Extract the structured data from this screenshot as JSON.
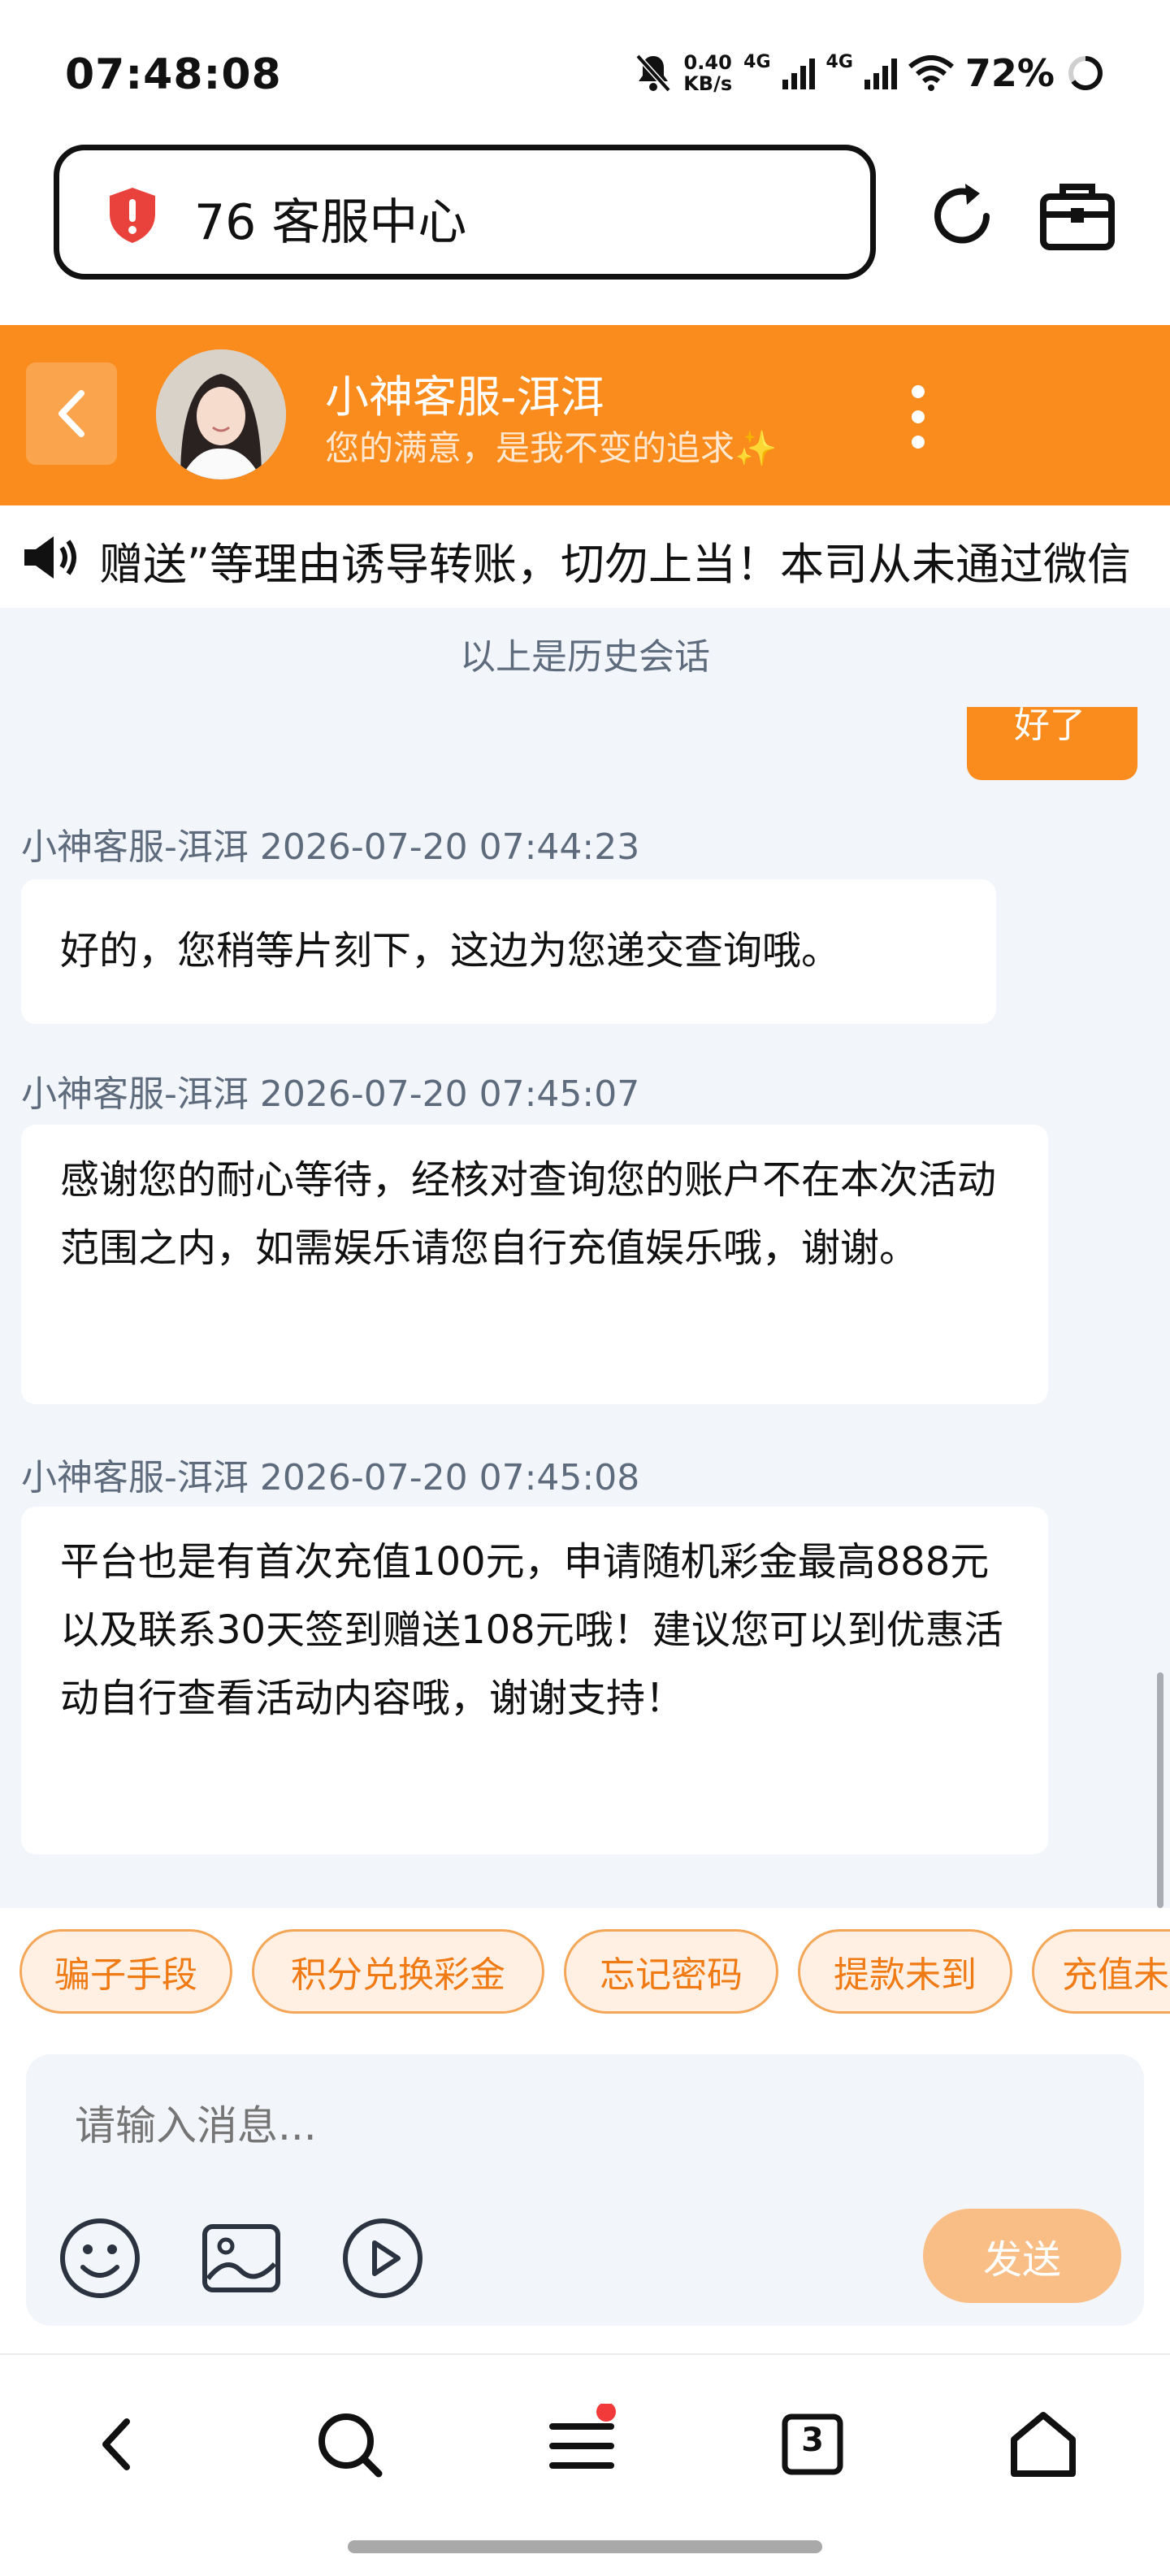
{
  "status_bar": {
    "time": "07:48:08",
    "speed_value": "0.40",
    "speed_unit": "KB/s",
    "net1": "4G",
    "net2": "4G",
    "battery": "72%"
  },
  "browser": {
    "address": "76 客服中心",
    "tab_count": "3"
  },
  "chat_header": {
    "agent_name": "小神客服-洱洱",
    "slogan": "您的满意，是我不变的追求✨"
  },
  "notice": {
    "text": "赠送”等理由诱导转账，切勿上当！本司从未通过微信"
  },
  "chat": {
    "history_label": "以上是历史会话",
    "user_message": "好了",
    "messages": [
      {
        "sender": "小神客服-洱洱",
        "time": "2026-07-20 07:44:23",
        "text": "好的，您稍等片刻下，这边为您递交查询哦。"
      },
      {
        "sender": "小神客服-洱洱",
        "time": "2026-07-20 07:45:07",
        "text": "感谢您的耐心等待，经核对查询您的账户不在本次活动范围之内，如需娱乐请您自行充值娱乐哦，谢谢。"
      },
      {
        "sender": "小神客服-洱洱",
        "time": "2026-07-20 07:45:08",
        "text": "平台也是有首次充值100元，申请随机彩金最高888元以及联系30天签到赠送108元哦！建议您可以到优惠活动自行查看活动内容哦，谢谢支持！"
      }
    ]
  },
  "quick_replies": [
    "骗子手段",
    "积分兑换彩金",
    "忘记密码",
    "提款未到",
    "充值未"
  ],
  "input": {
    "placeholder": "请输入消息...",
    "send_label": "发送"
  },
  "colors": {
    "brand_orange": "#f98c1c",
    "chip_border": "#f4a658",
    "send_disabled": "#f9bd86"
  }
}
